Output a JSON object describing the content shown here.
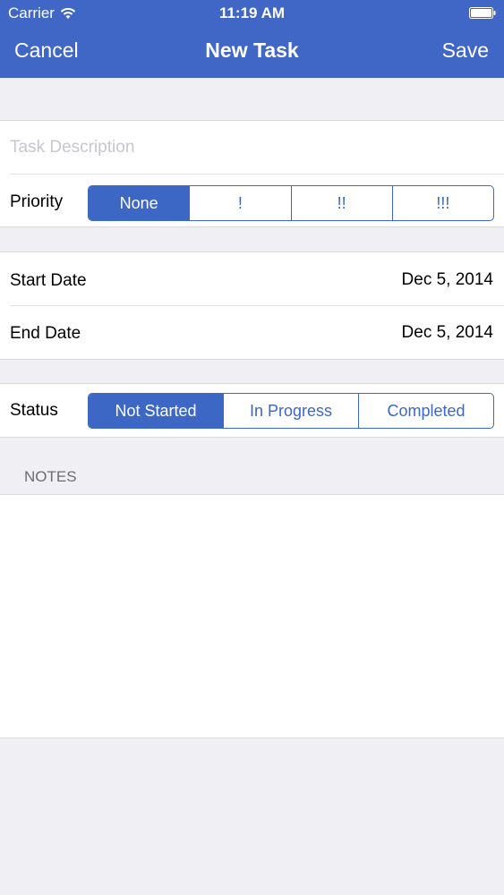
{
  "status_bar": {
    "carrier": "Carrier",
    "time": "11:19 AM"
  },
  "nav": {
    "left_label": "Cancel",
    "title": "New Task",
    "right_label": "Save",
    "color": "#4067c6"
  },
  "task": {
    "description_placeholder": "Task Description",
    "priority_label": "Priority",
    "priority_options": [
      "None",
      "!",
      "!!",
      "!!!"
    ],
    "priority_selected": "None"
  },
  "dates": {
    "start_label": "Start Date",
    "start_value": "Dec 5, 2014",
    "end_label": "End Date",
    "end_value": "Dec 5, 2014"
  },
  "status": {
    "label": "Status",
    "options": [
      "Not Started",
      "In Progress",
      "Completed"
    ],
    "selected": "Not Started"
  },
  "notes": {
    "header": "NOTES",
    "value": ""
  }
}
